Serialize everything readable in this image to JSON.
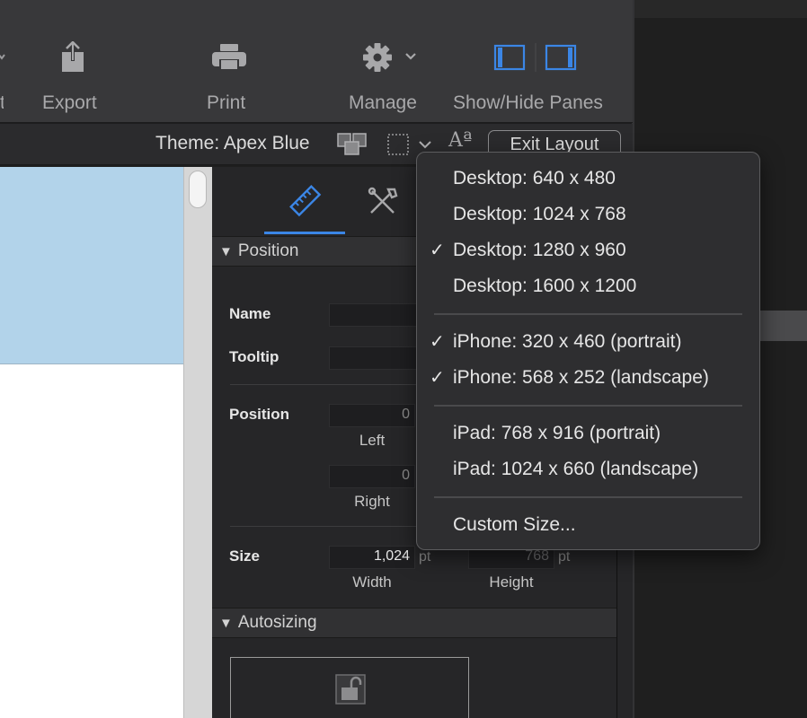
{
  "toolbar": {
    "items": [
      {
        "label": "Export",
        "icon": "share-export-icon"
      },
      {
        "label": "Print",
        "icon": "printer-icon"
      },
      {
        "label": "Manage",
        "icon": "gear-icon"
      },
      {
        "label": "Show/Hide Panes",
        "icon": "panes-toggle-icon"
      }
    ]
  },
  "themebar": {
    "theme_label": "Theme: Apex Blue",
    "exit_label": "Exit Layout"
  },
  "inspector": {
    "sections": {
      "position": "Position",
      "autosizing": "Autosizing"
    },
    "fields": {
      "name_label": "Name",
      "tooltip_label": "Tooltip",
      "position_label": "Position",
      "left_value": "0",
      "left_label": "Left",
      "right_value": "0",
      "right_label": "Right",
      "size_label": "Size",
      "width_value": "1,024",
      "width_unit": "pt",
      "width_label": "Width",
      "height_value": "768",
      "height_unit": "pt",
      "height_label": "Height"
    }
  },
  "size_menu": {
    "groups": [
      [
        {
          "label": "Desktop: 640 x 480",
          "checked": false
        },
        {
          "label": "Desktop: 1024 x 768",
          "checked": false
        },
        {
          "label": "Desktop: 1280 x 960",
          "checked": true
        },
        {
          "label": "Desktop: 1600 x 1200",
          "checked": false
        }
      ],
      [
        {
          "label": "iPhone: 320 x 460 (portrait)",
          "checked": true
        },
        {
          "label": "iPhone: 568 x 252 (landscape)",
          "checked": true
        }
      ],
      [
        {
          "label": "iPad: 768 x 916 (portrait)",
          "checked": false
        },
        {
          "label": "iPad: 1024 x 660 (landscape)",
          "checked": false
        }
      ],
      [
        {
          "label": "Custom Size...",
          "checked": false
        }
      ]
    ],
    "check_glyph": "✓"
  },
  "colors": {
    "accent": "#3b86e6",
    "toolbar_bg": "#38383a",
    "canvas_blue": "#b2d3ea"
  }
}
